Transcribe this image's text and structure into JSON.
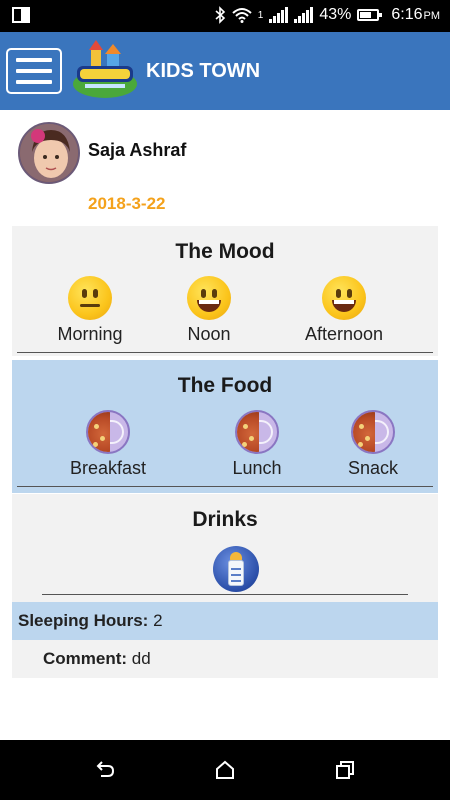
{
  "status_bar": {
    "battery_percent": "43%",
    "time": "6:16",
    "time_suffix": "PM",
    "network_label": "1"
  },
  "app_bar": {
    "title": "KIDS TOWN",
    "menu_icon": "hamburger-menu-icon",
    "logo_icon": "kids-town-logo"
  },
  "profile": {
    "name": "Saja Ashraf",
    "date": "2018-3-22"
  },
  "mood": {
    "title": "The Mood",
    "items": [
      {
        "label": "Morning",
        "icon": "neutral-face-icon"
      },
      {
        "label": "Noon",
        "icon": "grinning-face-icon"
      },
      {
        "label": "Afternoon",
        "icon": "grinning-face-icon"
      }
    ]
  },
  "food": {
    "title": "The Food",
    "items": [
      {
        "label": "Breakfast",
        "icon": "half-plate-icon"
      },
      {
        "label": "Lunch",
        "icon": "half-plate-icon"
      },
      {
        "label": "Snack",
        "icon": "half-plate-icon"
      }
    ]
  },
  "drinks": {
    "title": "Drinks",
    "icon": "baby-bottle-icon"
  },
  "sleeping": {
    "label": "Sleeping Hours:",
    "value": "2"
  },
  "comment": {
    "label": "Comment:",
    "value": "dd"
  },
  "colors": {
    "app_bar": "#3a75bd",
    "date_text": "#f4a21c",
    "section_grey": "#f2f2f2",
    "section_blue": "#bcd6ee"
  }
}
